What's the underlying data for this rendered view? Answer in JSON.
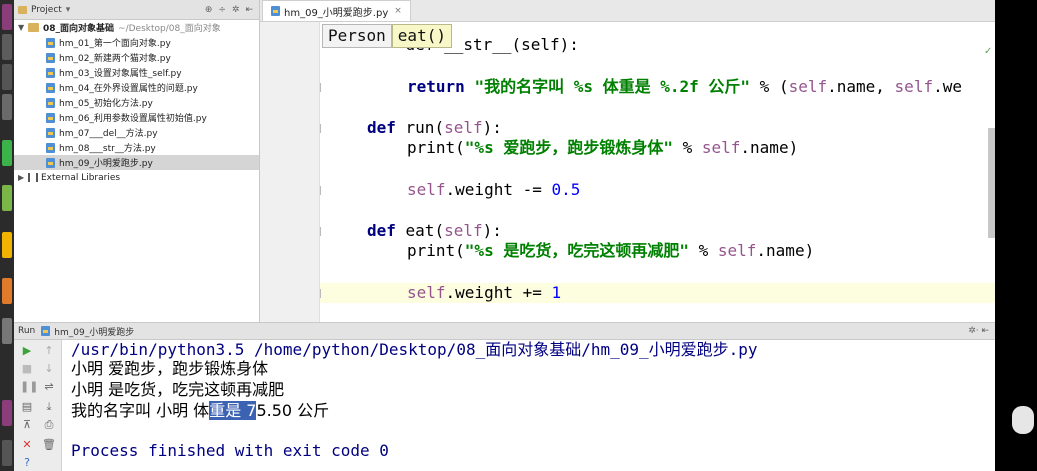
{
  "project_panel": {
    "header_label": "Project",
    "root_folder": "08_面向对象基础",
    "root_path": "~/Desktop/08_面向对象",
    "files": [
      "hm_01_第一个面向对象.py",
      "hm_02_新建两个猫对象.py",
      "hm_03_设置对象属性_self.py",
      "hm_04_在外界设置属性的问题.py",
      "hm_05_初始化方法.py",
      "hm_06_利用参数设置属性初始值.py",
      "hm_07___del__方法.py",
      "hm_08___str__方法.py",
      "hm_09_小明爱跑步.py"
    ],
    "selected_file": "hm_09_小明爱跑步.py",
    "libraries_label": "External Libraries"
  },
  "editor": {
    "tab_label": "hm_09_小明爱跑步.py",
    "breadcrumb": [
      "Person",
      "eat()"
    ],
    "partial_top_line": "    def __str__(self):",
    "lines": [
      {
        "num": "10",
        "text": ""
      },
      {
        "num": "11",
        "text": "return \"我的名字叫 %s 体重是 %.2f 公斤\" % (self.name, self.we"
      },
      {
        "num": "12",
        "text": ""
      },
      {
        "num": "13",
        "text": "def run(self):"
      },
      {
        "num": "14",
        "text": "print(\"%s 爱跑步，跑步锻炼身体\" % self.name)"
      },
      {
        "num": "15",
        "text": ""
      },
      {
        "num": "16",
        "text": "self.weight -= 0.5"
      },
      {
        "num": "17",
        "text": ""
      },
      {
        "num": "18",
        "text": "def eat(self):"
      },
      {
        "num": "19",
        "text": "print(\"%s 是吃货，吃完这顿再减肥\" % self.name)"
      },
      {
        "num": "20",
        "text": ""
      },
      {
        "num": "21",
        "text": "self.weight += 1"
      },
      {
        "num": "22",
        "text": ""
      }
    ],
    "current_line": "21"
  },
  "run_panel": {
    "header_label": "Run",
    "config_name": "hm_09_小明爱跑步",
    "console": {
      "command": "/usr/bin/python3.5 /home/python/Desktop/08_面向对象基础/hm_09_小明爱跑步.py",
      "output1": "小明 爱跑步，跑步锻炼身体",
      "output2": "小明 是吃货，吃完这顿再减肥",
      "output3_before": "我的名字叫 小明 体",
      "output3_selected": "重是 7",
      "output3_after": "5.50 公斤",
      "exit_message": "Process finished with exit code 0"
    }
  },
  "colors": {
    "keyword": "#000080",
    "string": "#008000",
    "self": "#94558d",
    "number": "#0000ff",
    "selection": "#3c62b3",
    "current_line": "#fdfde0"
  }
}
